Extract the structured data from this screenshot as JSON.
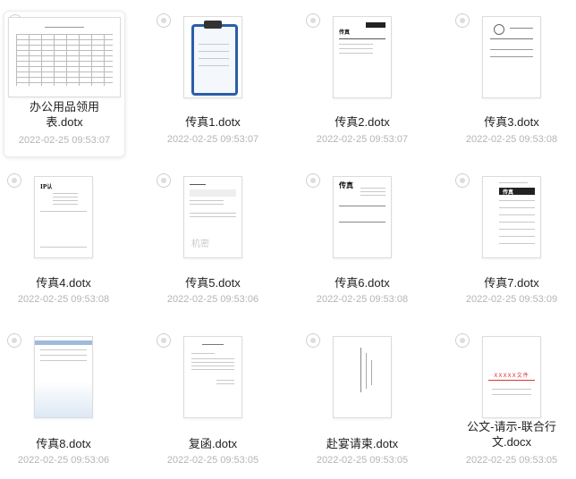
{
  "files": [
    {
      "name": "办公用品领用表.dotx",
      "name_line1": "办公用品领用",
      "name_line2": "表.dotx",
      "date": "2022-02-25 09:53:07"
    },
    {
      "name": "传真1.dotx",
      "date": "2022-02-25 09:53:07"
    },
    {
      "name": "传真2.dotx",
      "date": "2022-02-25 09:53:07"
    },
    {
      "name": "传真3.dotx",
      "date": "2022-02-25 09:53:08"
    },
    {
      "name": "传真4.dotx",
      "date": "2022-02-25 09:53:08"
    },
    {
      "name": "传真5.dotx",
      "date": "2022-02-25 09:53:06"
    },
    {
      "name": "传真6.dotx",
      "date": "2022-02-25 09:53:08"
    },
    {
      "name": "传真7.dotx",
      "date": "2022-02-25 09:53:09"
    },
    {
      "name": "传真8.dotx",
      "date": "2022-02-25 09:53:06"
    },
    {
      "name": "复函.dotx",
      "date": "2022-02-25 09:53:05"
    },
    {
      "name": "赴宴请柬.dotx",
      "date": "2022-02-25 09:53:05"
    },
    {
      "name": "公文-请示-联合行文.docx",
      "name_line1": "公文-请示-联合行",
      "name_line2": "文.docx",
      "date": "2022-02-25 09:53:05"
    }
  ],
  "thumb_text": {
    "fax2_title": "传真",
    "fax6_title": "传真",
    "fax7_title": "传真",
    "fax4_title": "IP认",
    "fax5_stamp": "机密",
    "gongwen_title": "XXXXX文件"
  }
}
